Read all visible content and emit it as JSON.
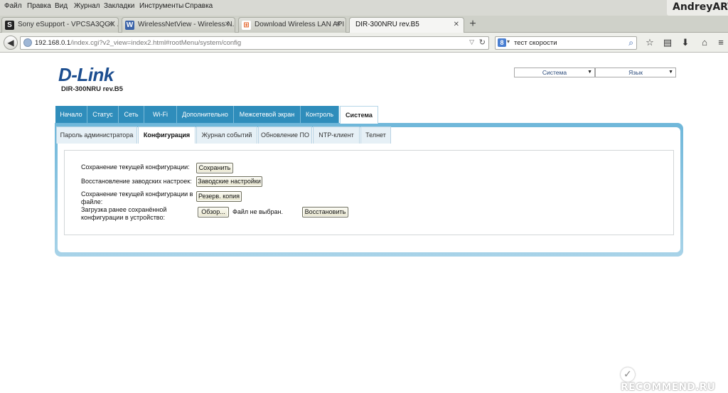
{
  "browser": {
    "menu": [
      "Файл",
      "Правка",
      "Вид",
      "Журнал",
      "Закладки",
      "Инструменты",
      "Справка"
    ],
    "user_watermark": "AndreyART",
    "tabs": [
      {
        "title": "Sony eSupport - VPCSA3QGX ...",
        "icon": "S"
      },
      {
        "title": "WirelessNetView - Wireless N...",
        "icon": "W"
      },
      {
        "title": "Download Wireless LAN API (...",
        "icon": "⊞"
      },
      {
        "title": "DIR-300NRU rev.B5",
        "icon": ""
      }
    ],
    "new_tab": "+",
    "url_host": "192.168.0.1",
    "url_path": "/index.cgi?v2_view=index2.html#rootMenu/system/config",
    "search_value": "тест скорости"
  },
  "page": {
    "logo": "D-Link",
    "model": "DIR-300NRU rev.B5",
    "system_select": "Система",
    "language_select": "Язык",
    "main_tabs": [
      "Начало",
      "Статус",
      "Сеть",
      "Wi-Fi",
      "Дополнительно",
      "Межсетевой экран",
      "Контроль",
      "Система"
    ],
    "active_main_tab": "Система",
    "sub_tabs": [
      "Пароль администратора",
      "Конфигурация",
      "Журнал событий",
      "Обновление ПО",
      "NTP-клиент",
      "Телнет"
    ],
    "active_sub_tab": "Конфигурация",
    "rows": {
      "save_label": "Сохранение текущей конфигурации:",
      "save_button": "Сохранить",
      "factory_label": "Восстановление заводских настроек:",
      "factory_button": "Заводские настройки",
      "backup_label_1": "Сохранение текущей конфигурации в",
      "backup_label_2": "файле:",
      "backup_button": "Резерв. копия",
      "load_label_1": "Загрузка ранее сохранённой",
      "load_label_2": "конфигурации в устройство:",
      "browse_button": "Обзор...",
      "no_file": "Файл не выбран.",
      "restore_button": "Восстановить"
    }
  },
  "badge": "RECOMMEND.RU",
  "colors": {
    "brand_blue": "#1b4d8f",
    "tab_blue": "#2f8dbb",
    "panel_blue": "#6fb7da"
  }
}
